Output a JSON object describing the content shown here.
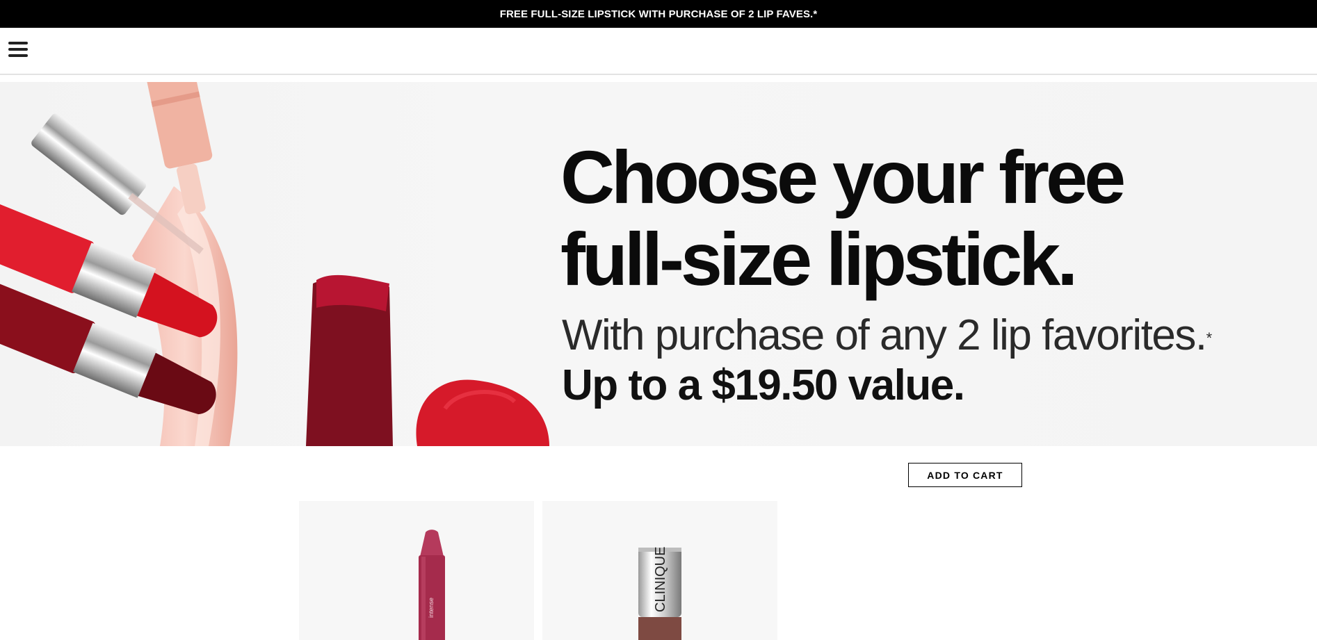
{
  "promo": {
    "text": "FREE FULL-SIZE LIPSTICK WITH PURCHASE OF 2 LIP FAVES.*"
  },
  "header": {
    "menu_icon": "hamburger-menu-icon"
  },
  "hero": {
    "title_line1": "Choose your free",
    "title_line2": "full-size lipstick.",
    "subtitle": "With purchase of any 2 lip favorites.",
    "subtitle_mark": "*",
    "value_text": "Up to a $19.50 value."
  },
  "cta": {
    "add_to_cart": "ADD TO CART"
  },
  "products": [
    {
      "image_alt": "lip balm crayon"
    },
    {
      "image_alt": "lipstick"
    }
  ],
  "product_2_brand": "CLINIQUE",
  "colors": {
    "promo_bg": "#000000",
    "promo_text": "#ffffff",
    "hero_bg": "#f4f4f4",
    "button_border": "#000000"
  }
}
